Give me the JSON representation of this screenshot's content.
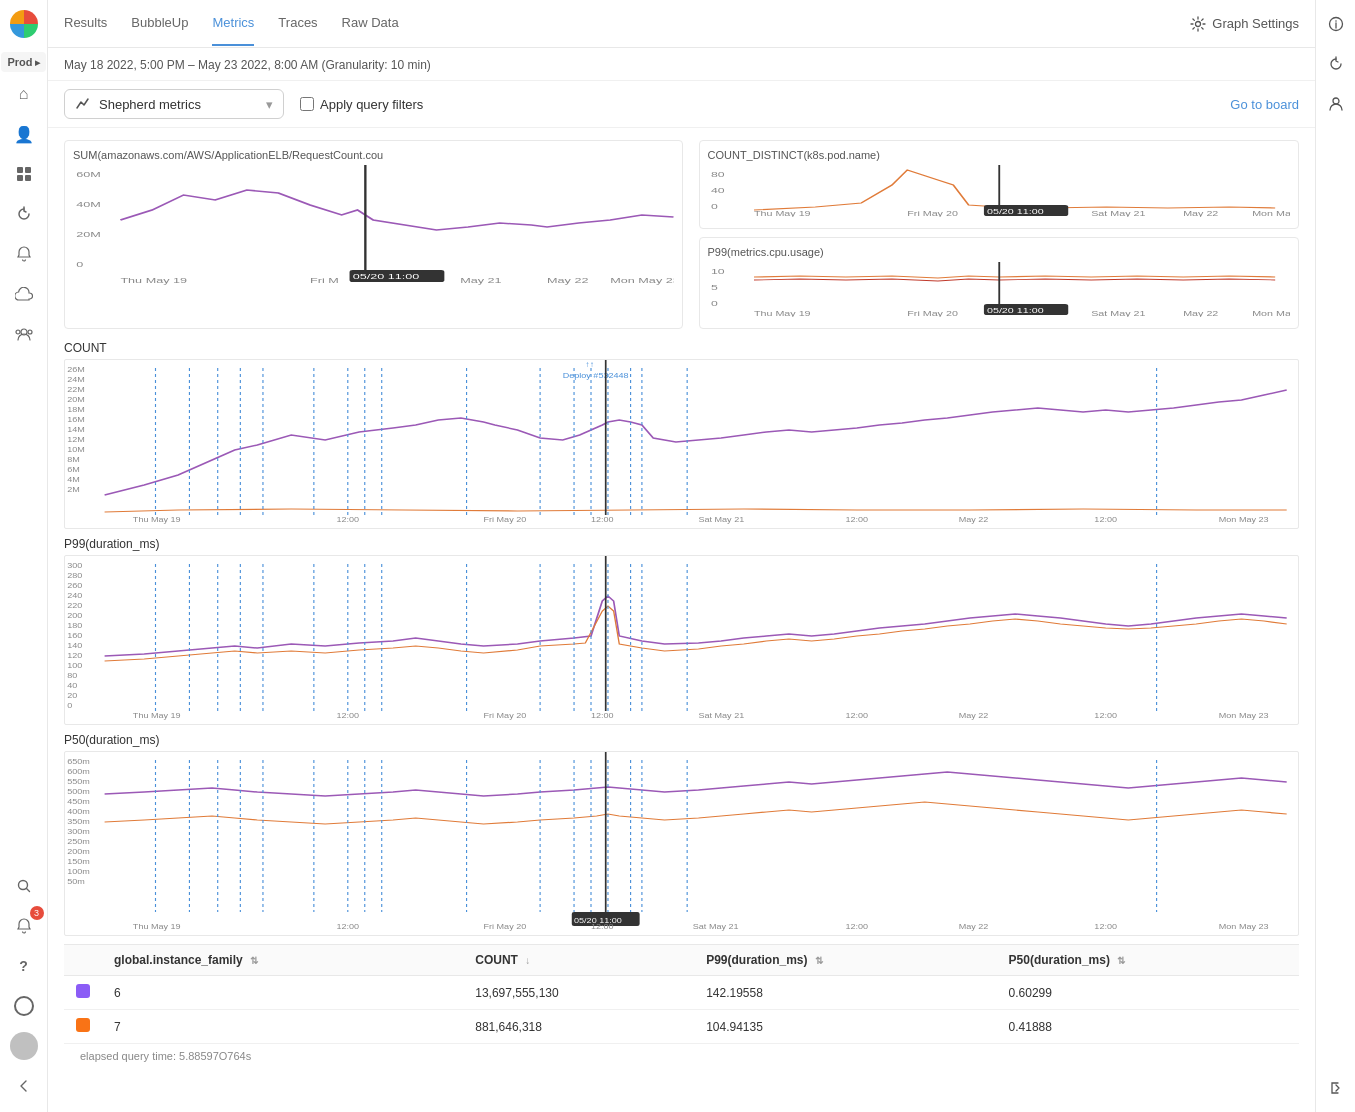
{
  "sidebar": {
    "env_label": "Prod",
    "items": [
      {
        "name": "home-icon",
        "icon": "⌂",
        "active": false
      },
      {
        "name": "users-icon",
        "icon": "👤",
        "active": false
      },
      {
        "name": "grid-icon",
        "icon": "⊞",
        "active": false
      },
      {
        "name": "history-icon",
        "icon": "↺",
        "active": false
      },
      {
        "name": "bell-icon",
        "icon": "🔔",
        "active": false
      },
      {
        "name": "cloud-icon",
        "icon": "☁",
        "active": false
      },
      {
        "name": "group-icon",
        "icon": "👥",
        "active": false
      }
    ],
    "bottom_items": [
      {
        "name": "search-icon",
        "icon": "🔍"
      },
      {
        "name": "notification-icon",
        "icon": "🔔",
        "badge": "3"
      },
      {
        "name": "help-icon",
        "icon": "?"
      },
      {
        "name": "status-icon",
        "icon": "○"
      }
    ]
  },
  "top_nav": {
    "tabs": [
      {
        "label": "Results",
        "active": false
      },
      {
        "label": "BubbleUp",
        "active": false
      },
      {
        "label": "Metrics",
        "active": true
      },
      {
        "label": "Traces",
        "active": false
      },
      {
        "label": "Raw Data",
        "active": false
      }
    ],
    "graph_settings": "Graph Settings"
  },
  "date_range": "May 18 2022, 5:00 PM – May 23 2022, 8:00 AM (Granularity: 10 min)",
  "toolbar": {
    "dropdown_label": "Shepherd metrics",
    "checkbox_label": "Apply query filters",
    "go_to_board": "Go to board"
  },
  "charts": {
    "chart1_title": "SUM(amazonaws.com/AWS/ApplicationELB/RequestCount.cou",
    "chart2_title": "COUNT_DISTINCT(k8s.pod.name)",
    "chart3_title": "P99(metrics.cpu.usage)",
    "chart4_title": "COUNT",
    "chart5_title": "P99(duration_ms)",
    "chart6_title": "P50(duration_ms)",
    "deploy_label": "Deploy #532448",
    "cursor_label": "05/20 11:00",
    "cursor_label2": "05/20 11:00",
    "cursor_label3": "05/20 11:00"
  },
  "table": {
    "columns": [
      {
        "label": "global.instance_family",
        "sortable": true
      },
      {
        "label": "COUNT",
        "sortable": true
      },
      {
        "label": "P99(duration_ms)",
        "sortable": true
      },
      {
        "label": "P50(duration_ms)",
        "sortable": true
      }
    ],
    "rows": [
      {
        "color": "#8b5cf6",
        "instance": "6",
        "count": "13,697,555,130",
        "p99": "142.19558",
        "p50": "0.60299"
      },
      {
        "color": "#f97316",
        "instance": "7",
        "count": "881,646,318",
        "p99": "104.94135",
        "p50": "0.41888"
      }
    ]
  },
  "elapsed": "elapsed query time: 5.88597O764s",
  "right_sidebar": {
    "items": [
      {
        "name": "info-icon",
        "icon": "ℹ"
      },
      {
        "name": "history-icon",
        "icon": "⟳"
      },
      {
        "name": "person-icon",
        "icon": "👤"
      },
      {
        "name": "collapse-icon",
        "icon": "⇥"
      }
    ]
  }
}
